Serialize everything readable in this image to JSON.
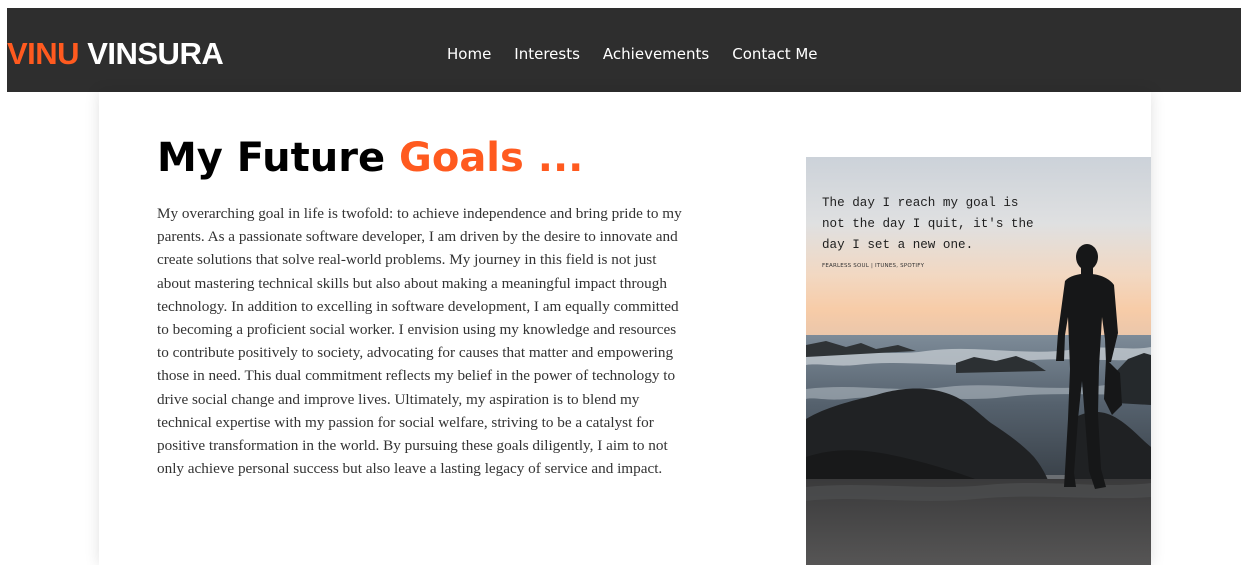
{
  "brand": {
    "first": "VINU",
    "last": "VINSURA"
  },
  "nav": {
    "items": [
      {
        "label": "Home"
      },
      {
        "label": "Interests"
      },
      {
        "label": "Achievements"
      },
      {
        "label": "Contact Me"
      }
    ]
  },
  "main": {
    "heading_plain": "My Future ",
    "heading_accent": "Goals ...",
    "paragraph": "My overarching goal in life is twofold: to achieve independence and bring pride to my parents. As a passionate software developer, I am driven by the desire to innovate and create solutions that solve real-world problems. My journey in this field is not just about mastering technical skills but also about making a meaningful impact through technology. In addition to excelling in software development, I am equally committed to becoming a proficient social worker. I envision using my knowledge and resources to contribute positively to society, advocating for causes that matter and empowering those in need. This dual commitment reflects my belief in the power of technology to drive social change and improve lives. Ultimately, my aspiration is to blend my technical expertise with my passion for social welfare, striving to be a catalyst for positive transformation in the world. By pursuing these goals diligently, I aim to not only achieve personal success but also leave a lasting legacy of service and impact."
  },
  "poster": {
    "quote": "The day I reach my goal is not the day I quit, it's the day I set a new one.",
    "credit": "FEARLESS SOUL | ITUNES, SPOTIFY"
  },
  "colors": {
    "accent": "#ff5a1f",
    "navbar": "#2e2e2e",
    "text": "#333333"
  }
}
